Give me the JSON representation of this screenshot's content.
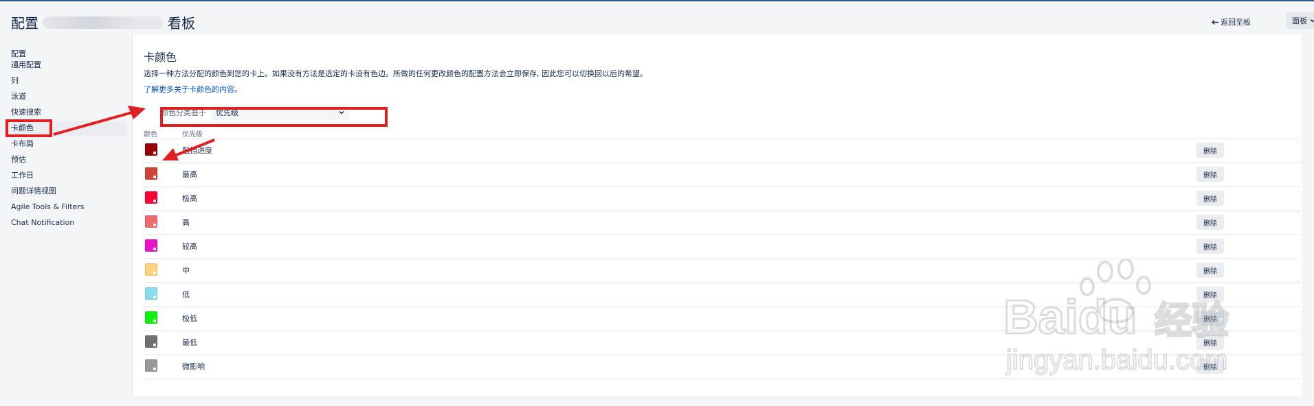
{
  "header": {
    "title_prefix": "配置",
    "title_suffix": "看板",
    "back_label": "返回至板",
    "board_label": "面板"
  },
  "sidebar": {
    "heading": "配置",
    "items": [
      {
        "label": "通用配置"
      },
      {
        "label": "列"
      },
      {
        "label": "泳道"
      },
      {
        "label": "快速搜索"
      },
      {
        "label": "卡颜色"
      },
      {
        "label": "卡布局"
      },
      {
        "label": "预估"
      },
      {
        "label": "工作日"
      },
      {
        "label": "问题详情视图"
      },
      {
        "label": "Agile Tools & Filters"
      },
      {
        "label": "Chat Notification"
      }
    ],
    "selected_index": 4
  },
  "main": {
    "heading": "卡颜色",
    "description": "选择一种方法分配的颜色到您的卡上。如果没有方法是选定的卡没有色边。所做的任何更改颜色的配置方法会立即保存, 因此您可以切换回以后的希望。",
    "learn_more": "了解更多关于卡颜色的内容。",
    "strategy_label": "颜色分类基于",
    "strategy_value": "优先级",
    "table": {
      "col_color": "颜色",
      "col_priority": "优先级",
      "delete_label": "删除",
      "rows": [
        {
          "label": "阻挡进度",
          "color": "#990000"
        },
        {
          "label": "最高",
          "color": "#d04437"
        },
        {
          "label": "极高",
          "color": "#ff0033"
        },
        {
          "label": "高",
          "color": "#f06c6c"
        },
        {
          "label": "较高",
          "color": "#ee11cc"
        },
        {
          "label": "中",
          "color": "#ffd27f"
        },
        {
          "label": "低",
          "color": "#88ddee"
        },
        {
          "label": "极低",
          "color": "#11ee11"
        },
        {
          "label": "最低",
          "color": "#707070"
        },
        {
          "label": "微影响",
          "color": "#999999"
        }
      ]
    }
  },
  "watermark": {
    "brand": "Baidu",
    "brand_cn": "经验",
    "url": "jingyan.baidu.com"
  },
  "colors": {
    "annotation_red": "#e02020",
    "link_blue": "#0052cc",
    "header_line": "#2f5c8a"
  }
}
